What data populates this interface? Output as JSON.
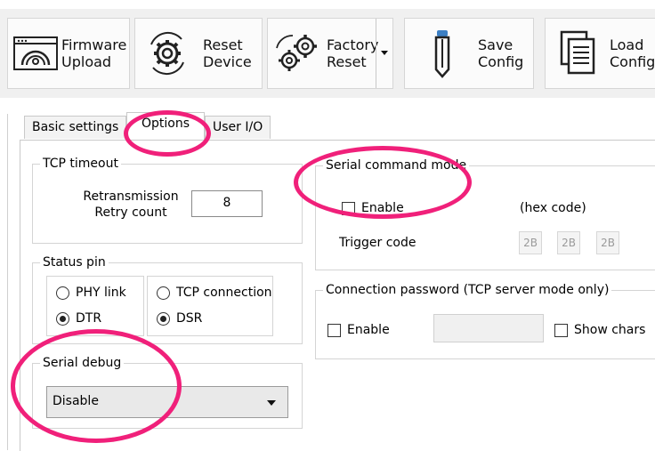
{
  "toolbar": {
    "firmware_upload": "Firmware\nUpload",
    "reset_device": "Reset\nDevice",
    "factory_reset": "Factory\nReset",
    "save_config": "Save\nConfig",
    "load_config": "Load\nConfig"
  },
  "tabs": [
    {
      "label": "Basic settings"
    },
    {
      "label": "Options"
    },
    {
      "label": "User I/O"
    }
  ],
  "tcp_timeout": {
    "title": "TCP timeout",
    "label": "Retransmission\nRetry count",
    "value": "8"
  },
  "status_pin": {
    "title": "Status pin",
    "group1": {
      "opt1": "PHY link",
      "opt2": "DTR"
    },
    "group2": {
      "opt1": "TCP connection",
      "opt2": "DSR"
    }
  },
  "serial_debug": {
    "title": "Serial debug",
    "selected": "Disable"
  },
  "serial_command_mode": {
    "title": "Serial command mode",
    "enable_label": "Enable",
    "hex_label": "(hex code)",
    "trigger_label": "Trigger code",
    "codes": [
      "2B",
      "2B",
      "2B"
    ]
  },
  "connection_password": {
    "title": "Connection password (TCP server mode only)",
    "enable_label": "Enable",
    "show_chars_label": "Show chars"
  },
  "colors": {
    "highlight": "#f0207a"
  }
}
